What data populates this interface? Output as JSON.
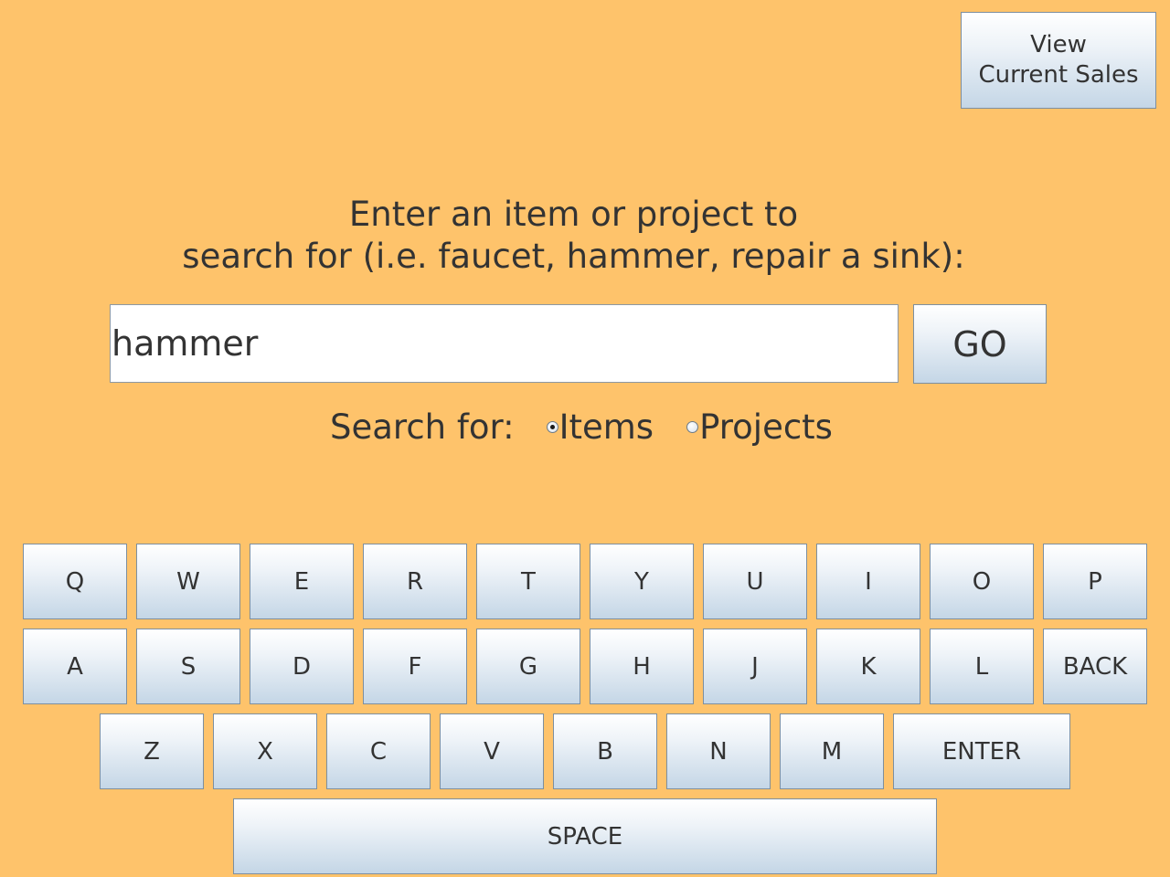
{
  "header": {
    "view_sales_line1": "View",
    "view_sales_line2": "Current Sales"
  },
  "prompt": {
    "line1": "Enter an item or project to",
    "line2": "search for (i.e. faucet, hammer, repair a sink):"
  },
  "search": {
    "value": "hammer",
    "go_label": "GO"
  },
  "search_type": {
    "label": "Search for:",
    "options": [
      {
        "label": "Items",
        "selected": true
      },
      {
        "label": "Projects",
        "selected": false
      }
    ]
  },
  "keyboard": {
    "row1": [
      "Q",
      "W",
      "E",
      "R",
      "T",
      "Y",
      "U",
      "I",
      "O",
      "P"
    ],
    "row2": [
      "A",
      "S",
      "D",
      "F",
      "G",
      "H",
      "J",
      "K",
      "L",
      "BACK"
    ],
    "row3": [
      "Z",
      "X",
      "C",
      "V",
      "B",
      "N",
      "M",
      "ENTER"
    ],
    "space_label": "SPACE"
  },
  "colors": {
    "background": "#fec36b",
    "text": "#333333",
    "button_top": "#ffffff",
    "button_bottom": "#c4d6e6"
  }
}
